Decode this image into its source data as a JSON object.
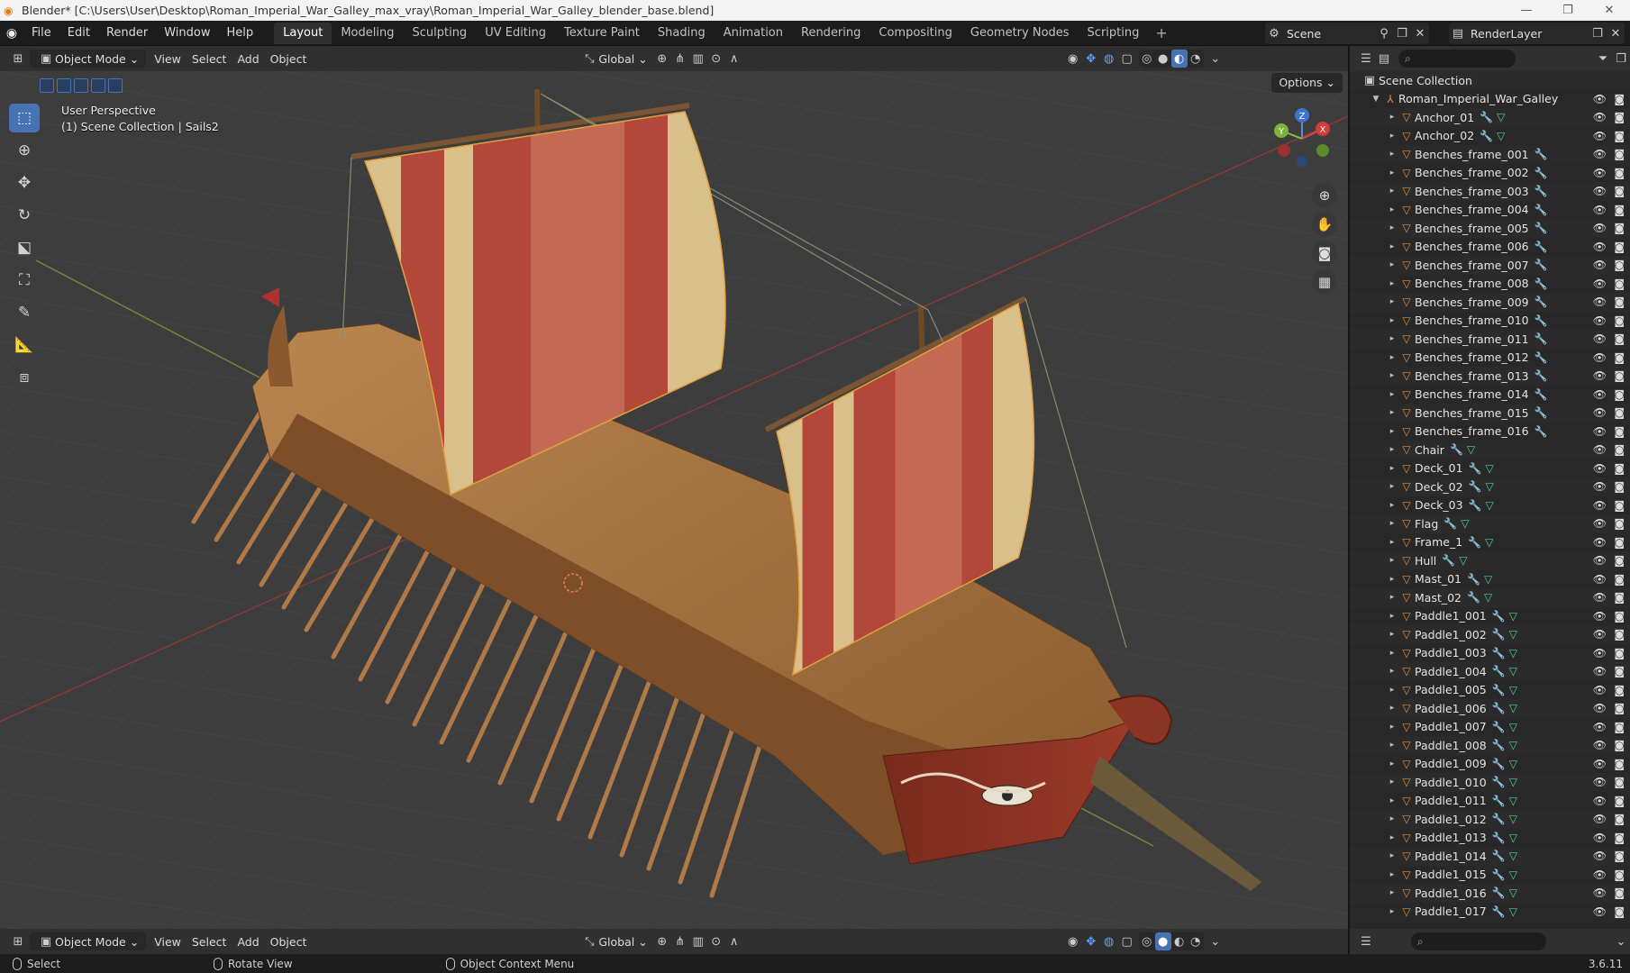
{
  "window": {
    "title": "Blender* [C:\\Users\\User\\Desktop\\Roman_Imperial_War_Galley_max_vray\\Roman_Imperial_War_Galley_blender_base.blend]",
    "minimize": "—",
    "maximize": "❐",
    "close": "✕"
  },
  "menu": [
    "File",
    "Edit",
    "Render",
    "Window",
    "Help"
  ],
  "workspaces": [
    "Layout",
    "Modeling",
    "Sculpting",
    "UV Editing",
    "Texture Paint",
    "Shading",
    "Animation",
    "Rendering",
    "Compositing",
    "Geometry Nodes",
    "Scripting"
  ],
  "active_workspace": "Layout",
  "scene": {
    "name": "Scene",
    "layer": "RenderLayer"
  },
  "viewport_header": {
    "mode": "Object Mode",
    "menus": [
      "View",
      "Select",
      "Add",
      "Object"
    ],
    "orientation": "Global",
    "options": "Options"
  },
  "viewport": {
    "perspective": "User Perspective",
    "collection_info": "(1) Scene Collection | Sails2",
    "gizmo": {
      "z": "Z",
      "y": "Y",
      "x": "X"
    }
  },
  "outliner": {
    "search_placeholder": "",
    "root": "Scene Collection",
    "collection": "Roman_Imperial_War_Galley",
    "objects": [
      {
        "name": "Anchor_01",
        "mod": true,
        "mesh": true
      },
      {
        "name": "Anchor_02",
        "mod": true,
        "mesh": true
      },
      {
        "name": "Benches_frame_001",
        "mod": true,
        "mesh": false
      },
      {
        "name": "Benches_frame_002",
        "mod": true,
        "mesh": false
      },
      {
        "name": "Benches_frame_003",
        "mod": true,
        "mesh": false
      },
      {
        "name": "Benches_frame_004",
        "mod": true,
        "mesh": false
      },
      {
        "name": "Benches_frame_005",
        "mod": true,
        "mesh": false
      },
      {
        "name": "Benches_frame_006",
        "mod": true,
        "mesh": false
      },
      {
        "name": "Benches_frame_007",
        "mod": true,
        "mesh": false
      },
      {
        "name": "Benches_frame_008",
        "mod": true,
        "mesh": false
      },
      {
        "name": "Benches_frame_009",
        "mod": true,
        "mesh": false
      },
      {
        "name": "Benches_frame_010",
        "mod": true,
        "mesh": false
      },
      {
        "name": "Benches_frame_011",
        "mod": true,
        "mesh": false
      },
      {
        "name": "Benches_frame_012",
        "mod": true,
        "mesh": false
      },
      {
        "name": "Benches_frame_013",
        "mod": true,
        "mesh": false
      },
      {
        "name": "Benches_frame_014",
        "mod": true,
        "mesh": false
      },
      {
        "name": "Benches_frame_015",
        "mod": true,
        "mesh": false
      },
      {
        "name": "Benches_frame_016",
        "mod": true,
        "mesh": false
      },
      {
        "name": "Chair",
        "mod": true,
        "mesh": true
      },
      {
        "name": "Deck_01",
        "mod": true,
        "mesh": true
      },
      {
        "name": "Deck_02",
        "mod": true,
        "mesh": true
      },
      {
        "name": "Deck_03",
        "mod": true,
        "mesh": true
      },
      {
        "name": "Flag",
        "mod": true,
        "mesh": true
      },
      {
        "name": "Frame_1",
        "mod": true,
        "mesh": true
      },
      {
        "name": "Hull",
        "mod": true,
        "mesh": true
      },
      {
        "name": "Mast_01",
        "mod": true,
        "mesh": true
      },
      {
        "name": "Mast_02",
        "mod": true,
        "mesh": true
      },
      {
        "name": "Paddle1_001",
        "mod": true,
        "mesh": true
      },
      {
        "name": "Paddle1_002",
        "mod": true,
        "mesh": true
      },
      {
        "name": "Paddle1_003",
        "mod": true,
        "mesh": true
      },
      {
        "name": "Paddle1_004",
        "mod": true,
        "mesh": true
      },
      {
        "name": "Paddle1_005",
        "mod": true,
        "mesh": true
      },
      {
        "name": "Paddle1_006",
        "mod": true,
        "mesh": true
      },
      {
        "name": "Paddle1_007",
        "mod": true,
        "mesh": true
      },
      {
        "name": "Paddle1_008",
        "mod": true,
        "mesh": true
      },
      {
        "name": "Paddle1_009",
        "mod": true,
        "mesh": true
      },
      {
        "name": "Paddle1_010",
        "mod": true,
        "mesh": true
      },
      {
        "name": "Paddle1_011",
        "mod": true,
        "mesh": true
      },
      {
        "name": "Paddle1_012",
        "mod": true,
        "mesh": true
      },
      {
        "name": "Paddle1_013",
        "mod": true,
        "mesh": true
      },
      {
        "name": "Paddle1_014",
        "mod": true,
        "mesh": true
      },
      {
        "name": "Paddle1_015",
        "mod": true,
        "mesh": true
      },
      {
        "name": "Paddle1_016",
        "mod": true,
        "mesh": true
      },
      {
        "name": "Paddle1_017",
        "mod": true,
        "mesh": true
      }
    ]
  },
  "statusbar": {
    "select": "Select",
    "rotate": "Rotate View",
    "context": "Object Context Menu",
    "version": "3.6.11"
  },
  "colors": {
    "accent": "#4772b3",
    "object_icon": "#e58a3a",
    "modifier_icon": "#5aa9ff",
    "mesh_icon": "#4fd18b",
    "sail_red": "#b2473a",
    "sail_cream": "#d9c08a",
    "wood": "#a8743e"
  }
}
